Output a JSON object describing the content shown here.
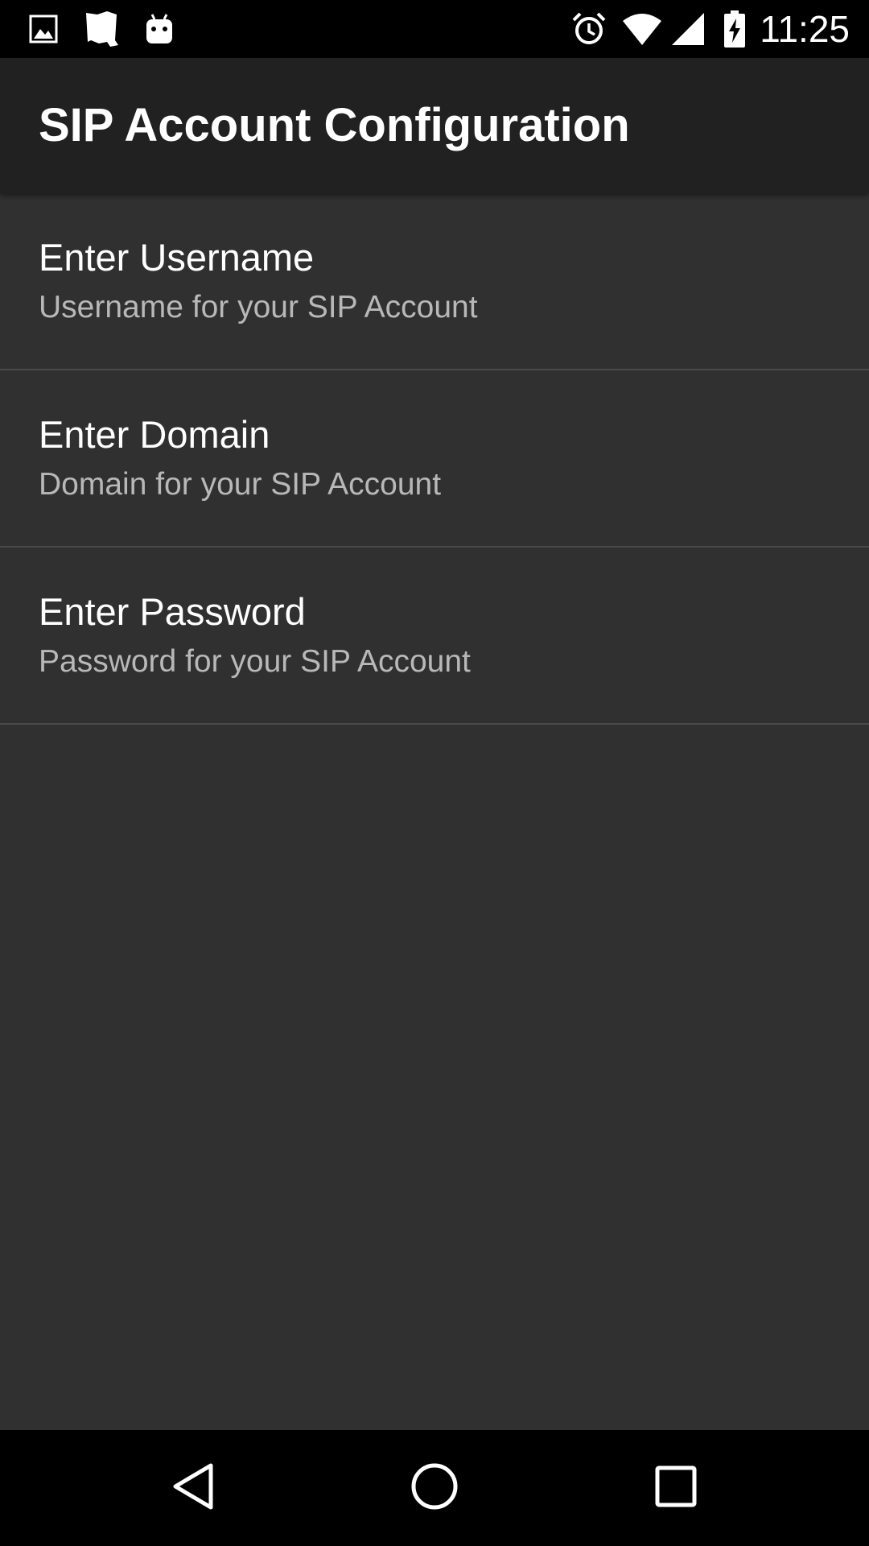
{
  "status_bar": {
    "time": "11:25",
    "left_icons": [
      "image-icon",
      "map-icon",
      "android-icon"
    ],
    "right_icons": [
      "alarm-icon",
      "wifi-icon",
      "signal-icon",
      "battery-charging-icon"
    ]
  },
  "app_bar": {
    "title": "SIP Account Configuration"
  },
  "preferences": [
    {
      "title": "Enter Username",
      "summary": "Username for your SIP Account"
    },
    {
      "title": "Enter Domain",
      "summary": "Domain for your SIP Account"
    },
    {
      "title": "Enter Password",
      "summary": "Password for your SIP Account"
    }
  ],
  "nav_bar": {
    "buttons": [
      "back-icon",
      "home-icon",
      "recents-icon"
    ]
  },
  "colors": {
    "background": "#303030",
    "app_bar": "#212121",
    "status_bar": "#000000",
    "nav_bar": "#000000",
    "divider": "#4a4a4a",
    "title_text": "#ffffff",
    "summary_text": "#b8b8b8"
  }
}
